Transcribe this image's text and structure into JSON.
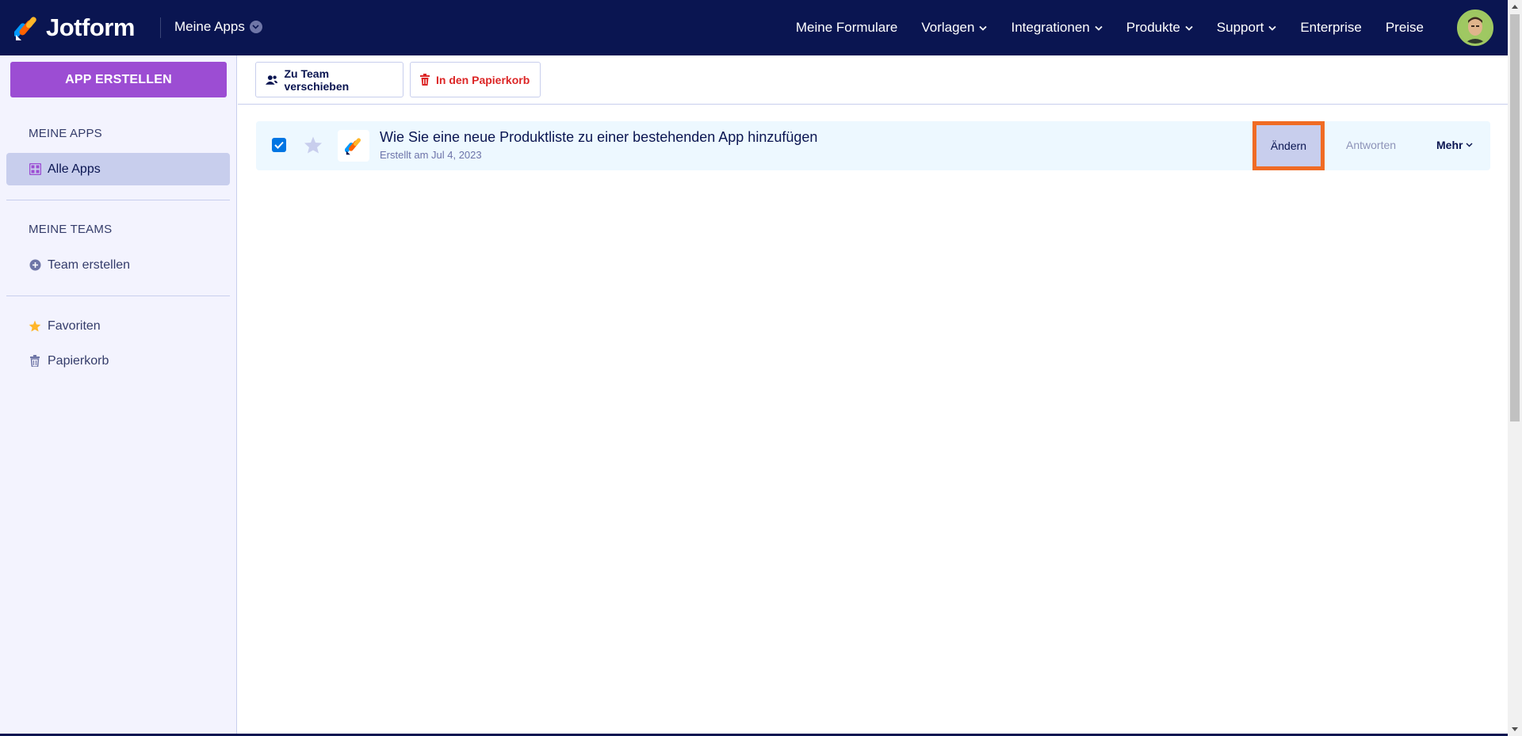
{
  "header": {
    "brand": "Jotform",
    "apps_switch_label": "Meine Apps",
    "nav": [
      {
        "label": "Meine Formulare",
        "has_dropdown": false
      },
      {
        "label": "Vorlagen",
        "has_dropdown": true
      },
      {
        "label": "Integrationen",
        "has_dropdown": true
      },
      {
        "label": "Produkte",
        "has_dropdown": true
      },
      {
        "label": "Support",
        "has_dropdown": true
      },
      {
        "label": "Enterprise",
        "has_dropdown": false
      },
      {
        "label": "Preise",
        "has_dropdown": false
      }
    ]
  },
  "sidebar": {
    "create_button": "APP ERSTELLEN",
    "my_apps_heading": "MEINE APPS",
    "all_apps": "Alle Apps",
    "my_teams_heading": "MEINE TEAMS",
    "create_team": "Team erstellen",
    "favorites": "Favoriten",
    "trash": "Papierkorb"
  },
  "toolbar": {
    "move_to_team": "Zu Team verschieben",
    "move_to_trash": "In den Papierkorb"
  },
  "apps": [
    {
      "title": "Wie Sie eine neue Produktliste zu einer bestehenden App hinzufügen",
      "created": "Erstellt am Jul 4, 2023",
      "checked": true,
      "starred": false,
      "edit_label": "Ändern",
      "answers_label": "Antworten",
      "more_label": "Mehr"
    }
  ],
  "colors": {
    "navy": "#0a1551",
    "purple": "#9c4dd3",
    "highlight": "#f06b24",
    "row_bg": "#edf8ff",
    "danger": "#dc2626"
  }
}
